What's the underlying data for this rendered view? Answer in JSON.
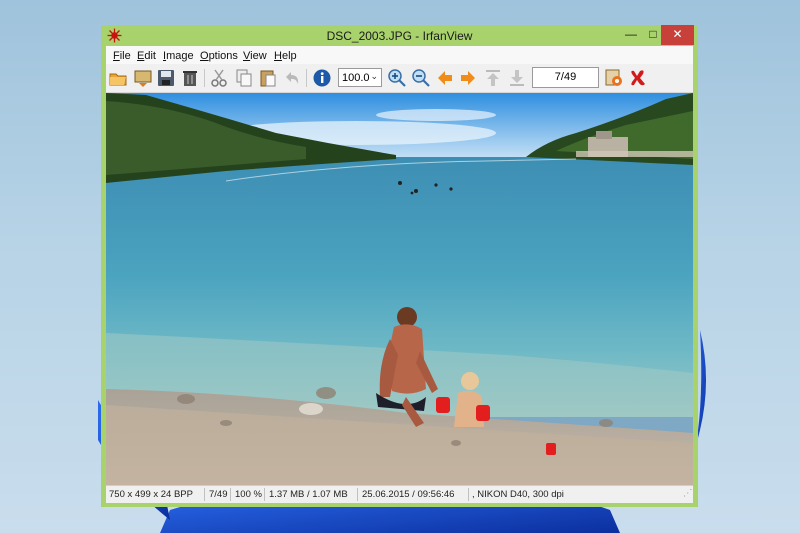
{
  "window": {
    "title": "DSC_2003.JPG - IrfanView",
    "controls": {
      "minimize": "—",
      "maximize": "□",
      "close": "✕"
    }
  },
  "menu": [
    {
      "key": "F",
      "rest": "ile"
    },
    {
      "key": "E",
      "rest": "dit"
    },
    {
      "key": "I",
      "rest": "mage"
    },
    {
      "key": "O",
      "rest": "ptions"
    },
    {
      "key": "V",
      "rest": "iew"
    },
    {
      "key": "H",
      "rest": "elp"
    }
  ],
  "toolbar": {
    "zoom_value": "100.0",
    "page_indicator": "7/49",
    "icons": [
      "open-folder-icon",
      "slideshow-icon",
      "save-icon",
      "delete-icon",
      "cut-icon",
      "copy-icon",
      "paste-icon",
      "undo-icon",
      "info-icon",
      "zoom-in-icon",
      "zoom-out-icon",
      "previous-icon",
      "next-icon",
      "first-icon",
      "last-icon",
      "settings-icon",
      "irfanview-exit-icon"
    ]
  },
  "statusbar": {
    "dimensions": "750 x 499 x 24 BPP",
    "position": "7/49",
    "zoom": "100 %",
    "size": "1.37 MB / 1.07 MB",
    "datetime": "25.06.2015 / 09:56:46",
    "camera": ", NIKON D40, 300 dpi"
  },
  "colors": {
    "window_frame": "#a8d26c",
    "close_button": "#c7403a",
    "desktop_bloom": "#1c4fd8"
  }
}
